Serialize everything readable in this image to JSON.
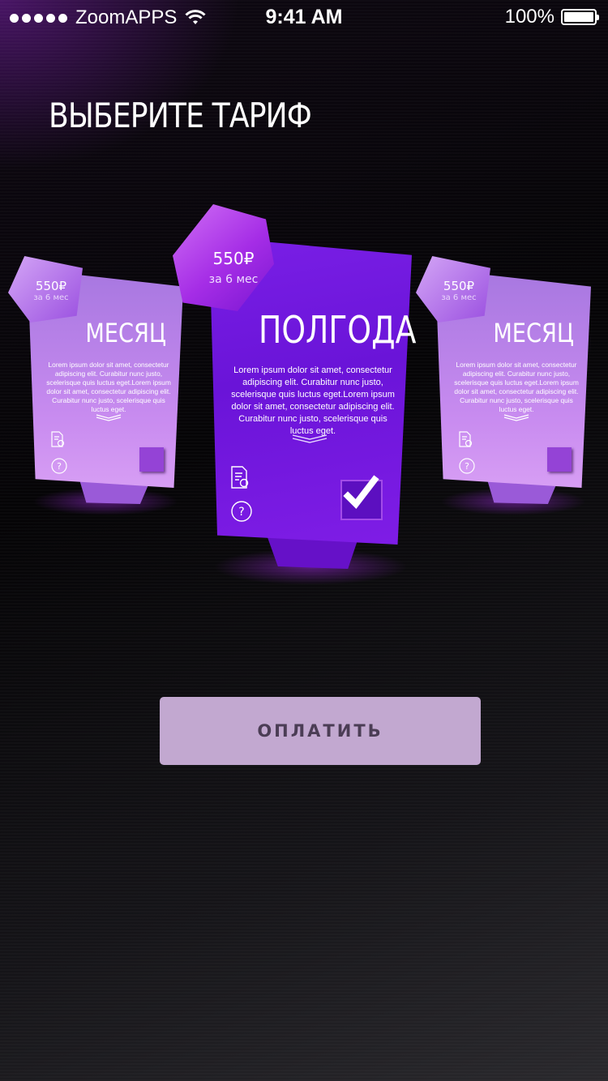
{
  "status_bar": {
    "carrier": "ZoomAPPS",
    "time": "9:41 AM",
    "battery": "100%"
  },
  "page": {
    "title": "ВЫБЕРИТЕ ТАРИФ"
  },
  "plans": [
    {
      "price": "550₽",
      "period": "за 6 мес",
      "name": "МЕСЯЦ",
      "description": "Lorem ipsum dolor sit amet, consectetur adipiscing elit. Curabitur nunc justo, scelerisque quis luctus eget.Lorem ipsum dolor sit amet, consectetur adipiscing elit. Curabitur nunc justo, scelerisque quis luctus eget.",
      "selected": false
    },
    {
      "price": "550₽",
      "period": "за 6 мес",
      "name": "ПОЛГОДА",
      "description": "Lorem ipsum dolor sit amet, consectetur adipiscing elit. Curabitur nunc justo, scelerisque quis luctus eget.Lorem ipsum dolor sit amet, consectetur adipiscing elit. Curabitur nunc justo, scelerisque quis luctus eget.",
      "selected": true
    },
    {
      "price": "550₽",
      "period": "за 6 мес",
      "name": "МЕСЯЦ",
      "description": "Lorem ipsum dolor sit amet, consectetur adipiscing elit. Curabitur nunc justo, scelerisque quis luctus eget.Lorem ipsum dolor sit amet, consectetur adipiscing elit. Curabitur nunc justo, scelerisque quis luctus eget.",
      "selected": false
    }
  ],
  "pay_button": {
    "label": "ОПЛАТИТЬ"
  },
  "icons": {
    "signal": "signal-dots-icon",
    "wifi": "wifi-icon",
    "battery": "battery-icon",
    "document": "certificate-document-icon",
    "help": "question-bubble-icon",
    "expand": "chevron-down-icon",
    "check": "checkmark-icon"
  },
  "colors": {
    "plan_selected": "#6a14d8",
    "plan_side": "#c98cf0",
    "pay_button_bg": "#c2a8d0",
    "pay_button_text": "#4b3d55"
  }
}
